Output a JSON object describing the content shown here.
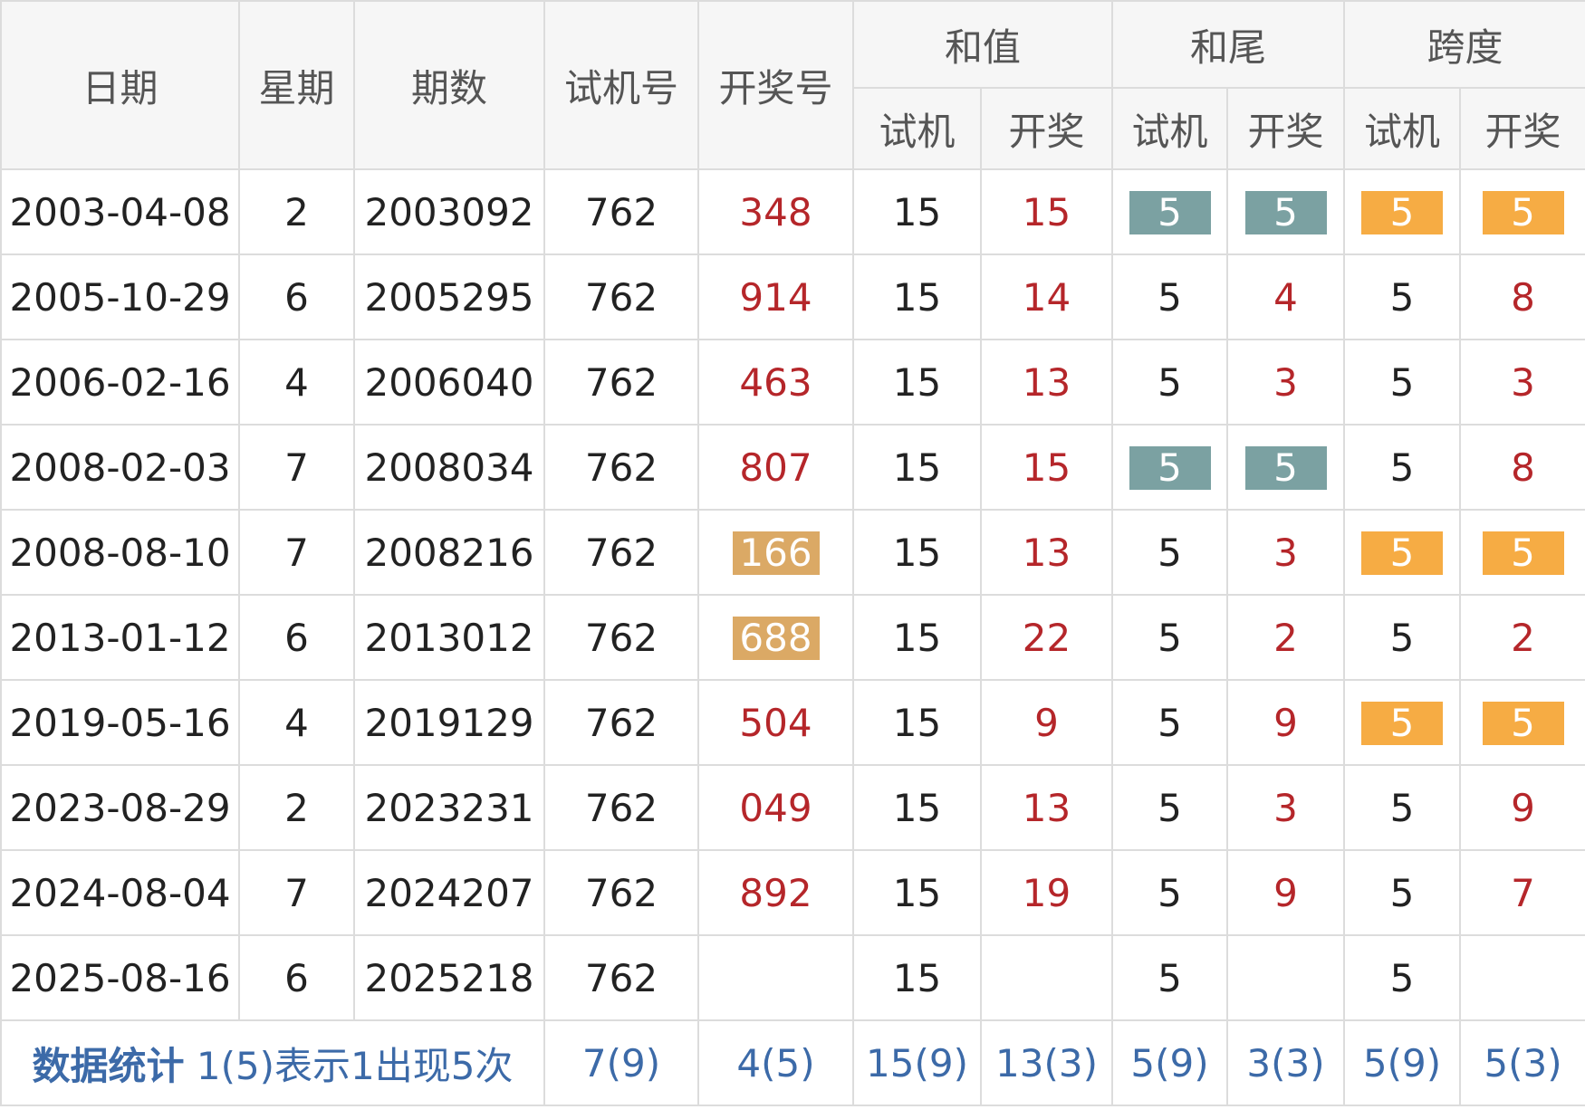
{
  "headers": {
    "date": "日期",
    "weekday": "星期",
    "issue": "期数",
    "trial": "试机号",
    "draw": "开奖号",
    "sum_group": "和值",
    "tail_group": "和尾",
    "span_group": "跨度",
    "sub_trial": "试机",
    "sub_draw": "开奖"
  },
  "rows": [
    {
      "date": "2003-04-08",
      "weekday": "2",
      "issue": "2003092",
      "trial": "762",
      "draw": "348",
      "sum_t": "15",
      "sum_d": "15",
      "tail_t": "5",
      "tail_d": "5",
      "span_t": "5",
      "span_d": "5"
    },
    {
      "date": "2005-10-29",
      "weekday": "6",
      "issue": "2005295",
      "trial": "762",
      "draw": "914",
      "sum_t": "15",
      "sum_d": "14",
      "tail_t": "5",
      "tail_d": "4",
      "span_t": "5",
      "span_d": "8"
    },
    {
      "date": "2006-02-16",
      "weekday": "4",
      "issue": "2006040",
      "trial": "762",
      "draw": "463",
      "sum_t": "15",
      "sum_d": "13",
      "tail_t": "5",
      "tail_d": "3",
      "span_t": "5",
      "span_d": "3"
    },
    {
      "date": "2008-02-03",
      "weekday": "7",
      "issue": "2008034",
      "trial": "762",
      "draw": "807",
      "sum_t": "15",
      "sum_d": "15",
      "tail_t": "5",
      "tail_d": "5",
      "span_t": "5",
      "span_d": "8"
    },
    {
      "date": "2008-08-10",
      "weekday": "7",
      "issue": "2008216",
      "trial": "762",
      "draw": "166",
      "sum_t": "15",
      "sum_d": "13",
      "tail_t": "5",
      "tail_d": "3",
      "span_t": "5",
      "span_d": "5"
    },
    {
      "date": "2013-01-12",
      "weekday": "6",
      "issue": "2013012",
      "trial": "762",
      "draw": "688",
      "sum_t": "15",
      "sum_d": "22",
      "tail_t": "5",
      "tail_d": "2",
      "span_t": "5",
      "span_d": "2"
    },
    {
      "date": "2019-05-16",
      "weekday": "4",
      "issue": "2019129",
      "trial": "762",
      "draw": "504",
      "sum_t": "15",
      "sum_d": "9",
      "tail_t": "5",
      "tail_d": "9",
      "span_t": "5",
      "span_d": "5"
    },
    {
      "date": "2023-08-29",
      "weekday": "2",
      "issue": "2023231",
      "trial": "762",
      "draw": "049",
      "sum_t": "15",
      "sum_d": "13",
      "tail_t": "5",
      "tail_d": "3",
      "span_t": "5",
      "span_d": "9"
    },
    {
      "date": "2024-08-04",
      "weekday": "7",
      "issue": "2024207",
      "trial": "762",
      "draw": "892",
      "sum_t": "15",
      "sum_d": "19",
      "tail_t": "5",
      "tail_d": "9",
      "span_t": "5",
      "span_d": "7"
    },
    {
      "date": "2025-08-16",
      "weekday": "6",
      "issue": "2025218",
      "trial": "762",
      "draw": "",
      "sum_t": "15",
      "sum_d": "",
      "tail_t": "5",
      "tail_d": "",
      "span_t": "5",
      "span_d": ""
    }
  ],
  "stats": {
    "label_bold": "数据统计",
    "label_note": "1(5)表示1出现5次",
    "trial": "7(9)",
    "draw": "4(5)",
    "sum_t": "15(9)",
    "sum_d": "13(3)",
    "tail_t": "5(9)",
    "tail_d": "3(3)",
    "span_t": "5(9)",
    "span_d": "5(3)"
  },
  "colors": {
    "draw_red": "#b5262a",
    "teal_chip": "#7ba1a2",
    "orange_chip": "#f6ac44",
    "tan_chip": "#dba965",
    "stats_blue": "#3c6aa8"
  }
}
